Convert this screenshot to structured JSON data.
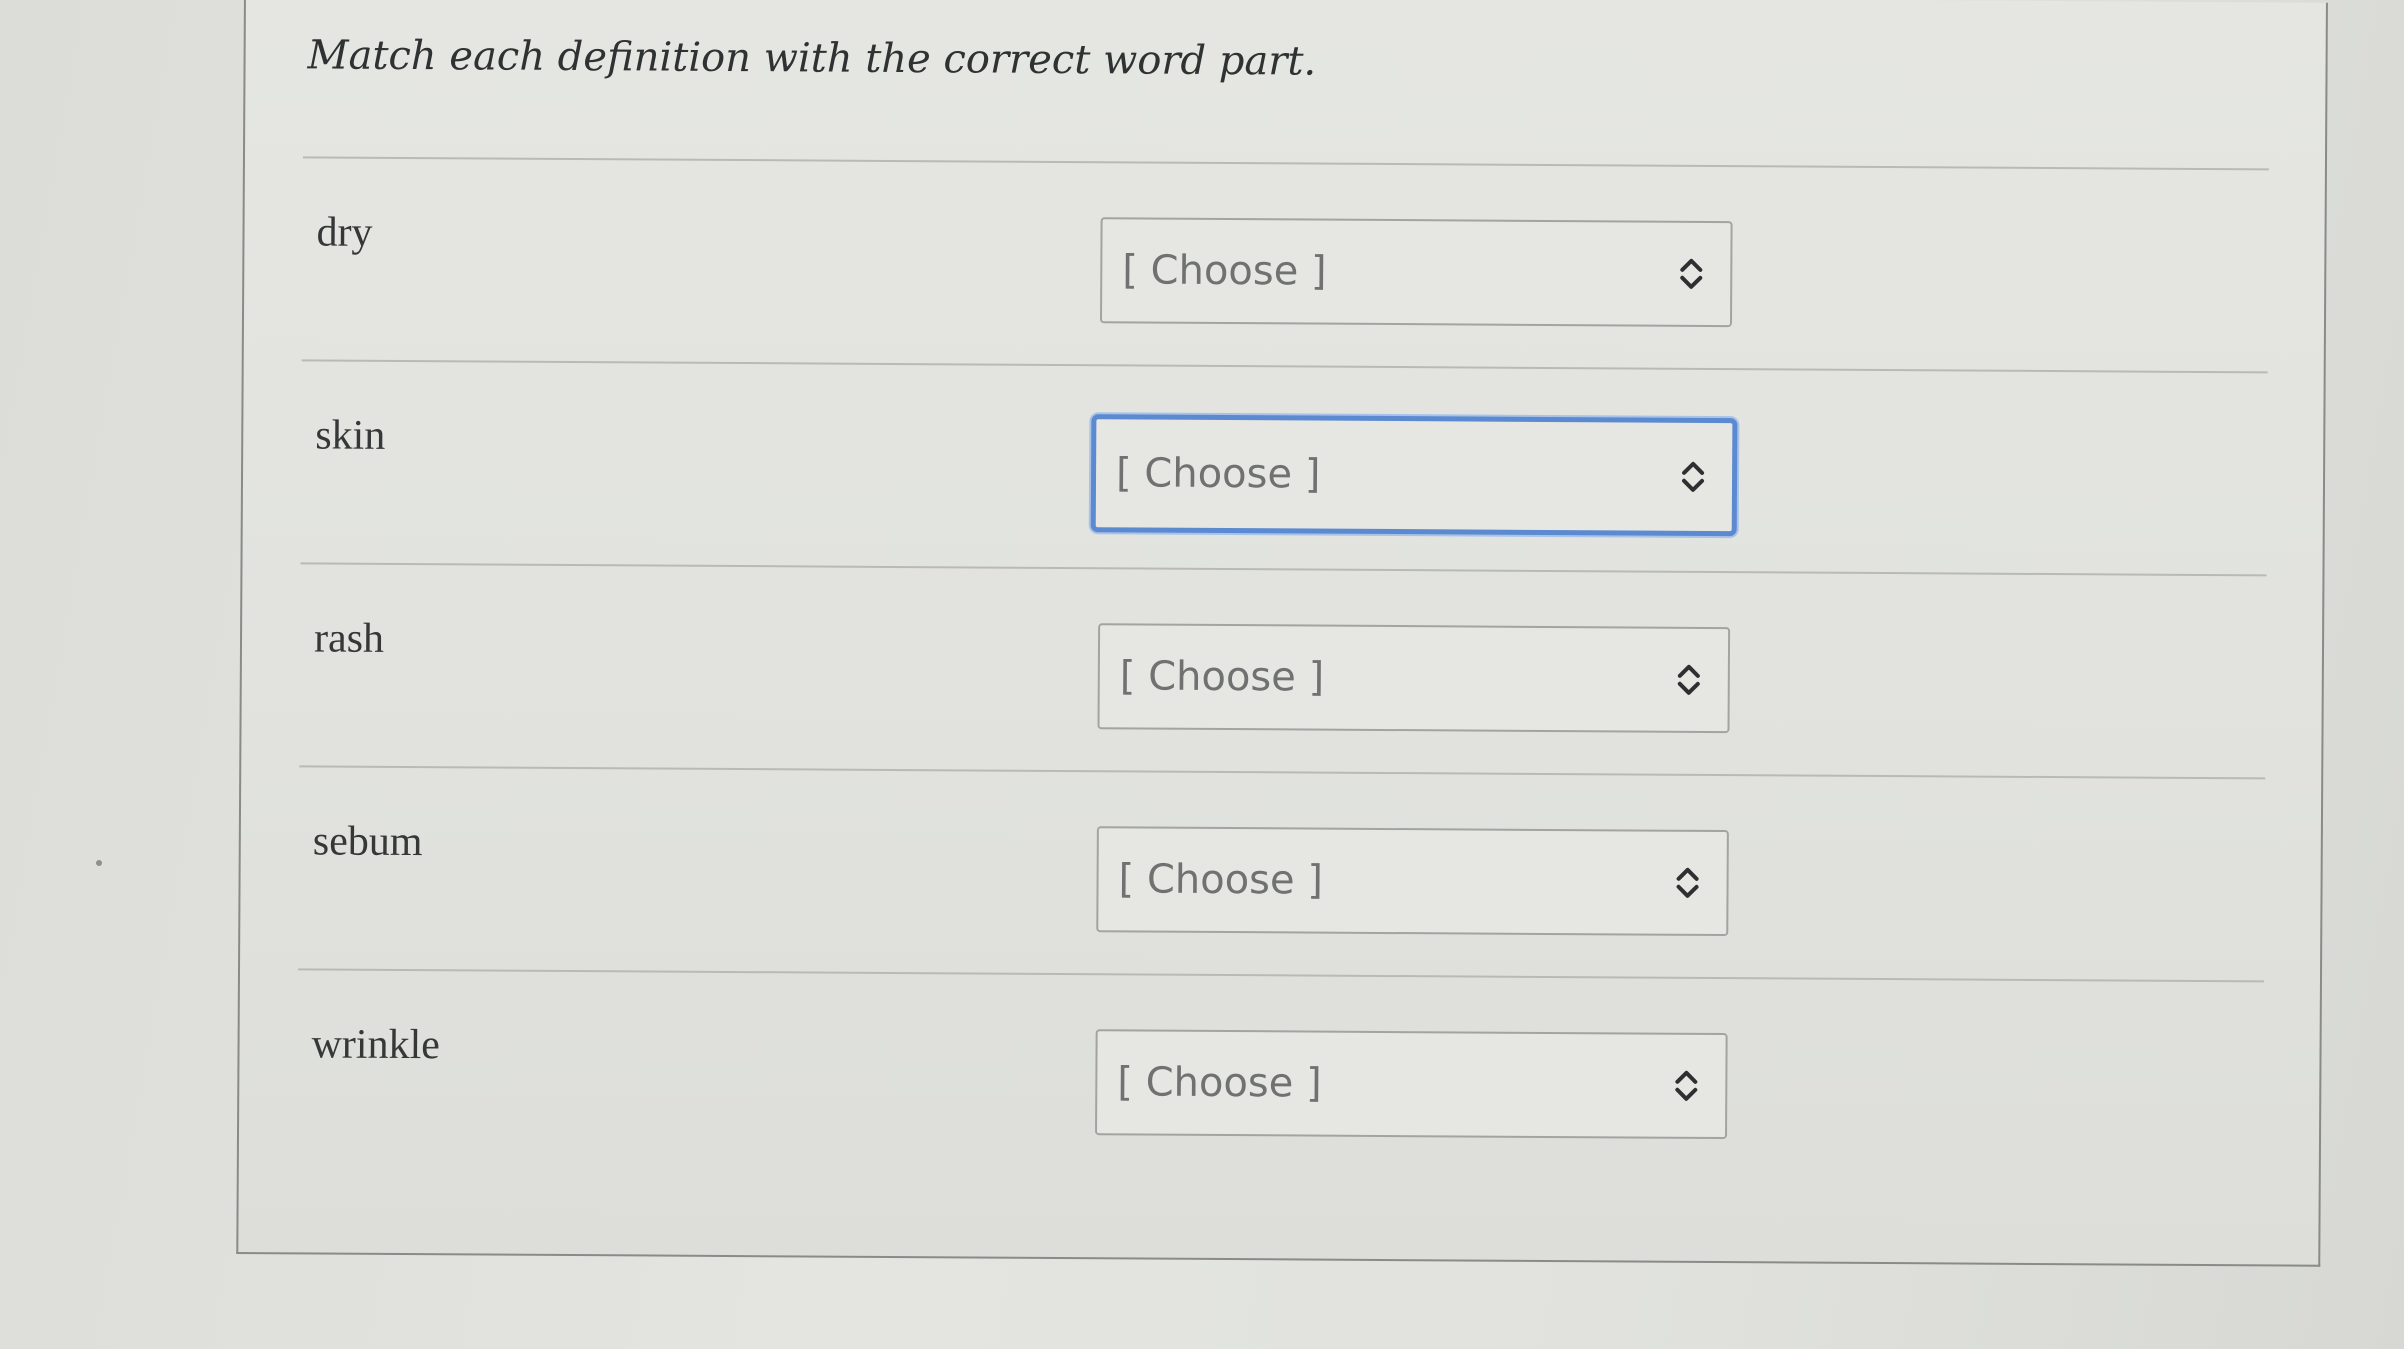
{
  "question": {
    "prompt": "Match each definition with the correct word part."
  },
  "matches": [
    {
      "term": "dry",
      "selected": "[ Choose ]",
      "focused": false
    },
    {
      "term": "skin",
      "selected": "[ Choose ]",
      "focused": true
    },
    {
      "term": "rash",
      "selected": "[ Choose ]",
      "focused": false
    },
    {
      "term": "sebum",
      "selected": "[ Choose ]",
      "focused": false
    },
    {
      "term": "wrinkle",
      "selected": "[ Choose ]",
      "focused": false
    }
  ],
  "icons": {
    "select_toggle": "chevron-up-down-icon"
  },
  "colors": {
    "focus_ring": "#5b8ad0",
    "text": "#363838",
    "placeholder": "#707271"
  }
}
